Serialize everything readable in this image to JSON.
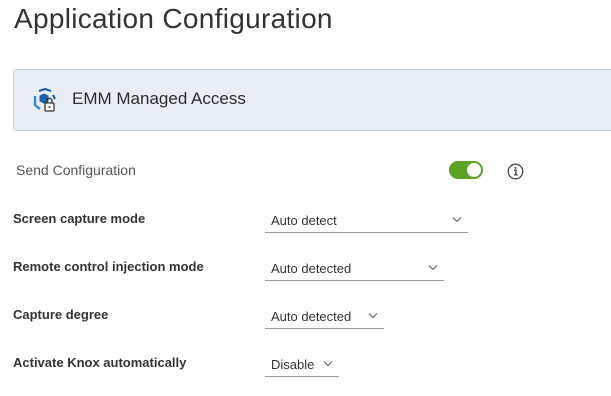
{
  "page": {
    "title": "Application Configuration"
  },
  "card": {
    "icon": "emm-managed-access-icon",
    "title": "EMM Managed Access"
  },
  "send_configuration": {
    "label": "Send Configuration",
    "enabled": true,
    "toggle_color": "#5aa220",
    "info_icon": "info-icon"
  },
  "fields": [
    {
      "label": "Screen capture mode",
      "value": "Auto detect"
    },
    {
      "label": "Remote control injection mode",
      "value": "Auto detected"
    },
    {
      "label": "Capture degree",
      "value": "Auto detected"
    },
    {
      "label": "Activate Knox automatically",
      "value": "Disable"
    }
  ]
}
